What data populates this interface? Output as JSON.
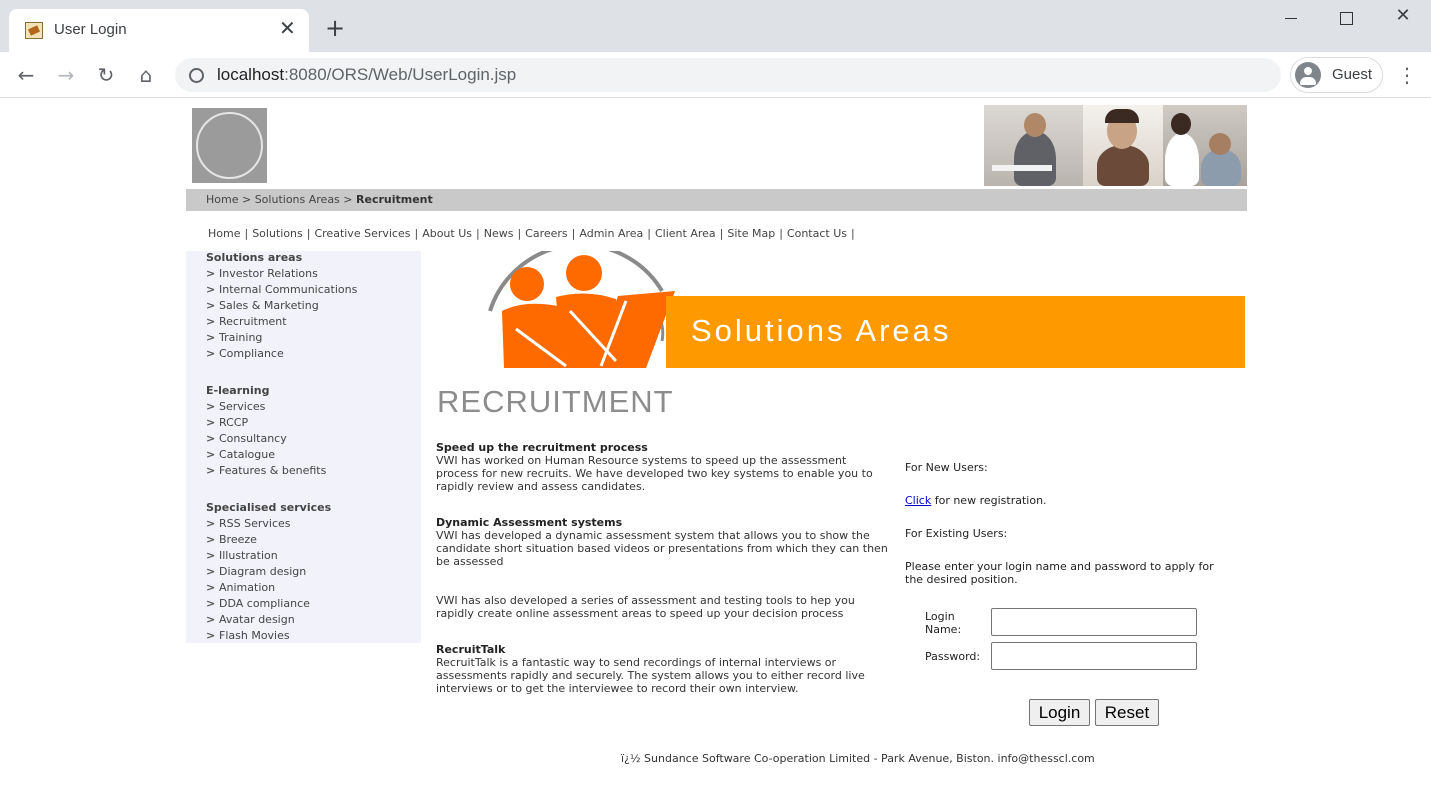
{
  "browser": {
    "tab_title": "User Login",
    "tab_close": "✕",
    "new_tab": "+",
    "url_host": "localhost",
    "url_path": ":8080/ORS/Web/UserLogin.jsp",
    "profile_label": "Guest",
    "icons": [
      "back-icon",
      "forward-icon",
      "reload-icon",
      "home-icon",
      "globe-icon",
      "menu-icon"
    ]
  },
  "breadcrumb": {
    "home": "Home",
    "sep": ">",
    "solutions": "Solutions Areas",
    "current": "Recruitment"
  },
  "topnav": [
    "Home",
    "Solutions",
    "Creative Services",
    "About Us",
    "News",
    "Careers",
    "Admin Area",
    "Client Area",
    "Site Map",
    "Contact Us"
  ],
  "topnav_sep": "|",
  "sidebar": {
    "groups": [
      {
        "heading": "Solutions areas",
        "items": [
          "Investor Relations",
          "Internal Communications",
          "Sales & Marketing",
          "Recruitment",
          "Training",
          "Compliance"
        ]
      },
      {
        "heading": "E-learning",
        "items": [
          "Services",
          "RCCP",
          "Consultancy",
          "Catalogue",
          "Features & benefits"
        ]
      },
      {
        "heading": "Specialised services",
        "items": [
          "RSS Services",
          "Breeze",
          "Illustration",
          "Diagram design",
          "Animation",
          "DDA compliance",
          "Avatar design",
          "Flash Movies"
        ]
      }
    ]
  },
  "banner": {
    "text": "Solutions Areas"
  },
  "page_heading": "RECRUITMENT",
  "articles": [
    {
      "title": "Speed up the recruitment process",
      "body": "VWI has worked on Human Resource systems to speed up the assessment process for new recruits. We have developed two key systems to enable you to rapidly review and assess candidates."
    },
    {
      "title": "Dynamic Assessment systems",
      "body": "VWI has developed a dynamic assessment system that allows you to show the candidate short situation based videos or presentations from which they can then be assessed"
    },
    {
      "title": "",
      "body": "VWI has also developed a series of assessment and testing tools to hep you rapidly create online assessment areas to speed up your decision process"
    },
    {
      "title": "RecruitTalk",
      "body": "RecruitTalk is a fantastic way to send recordings of internal interviews or assessments rapidly and securely. The system allows you to either record live interviews or to get the interviewee to record their own interview."
    }
  ],
  "login": {
    "new_users_heading": "For New Users:",
    "click_link": "Click",
    "click_rest": " for new registration.",
    "existing_users_heading": "For Existing Users:",
    "instructions": "Please enter your login name and password to apply for the desired position.",
    "login_name_label": "Login Name:",
    "password_label": "Password:",
    "login_name_value": "",
    "password_value": "",
    "login_button": "Login",
    "reset_button": "Reset"
  },
  "footer": "ï¿½ Sundance Software Co-operation Limited - Park Avenue, Biston. info@thesscl.com"
}
